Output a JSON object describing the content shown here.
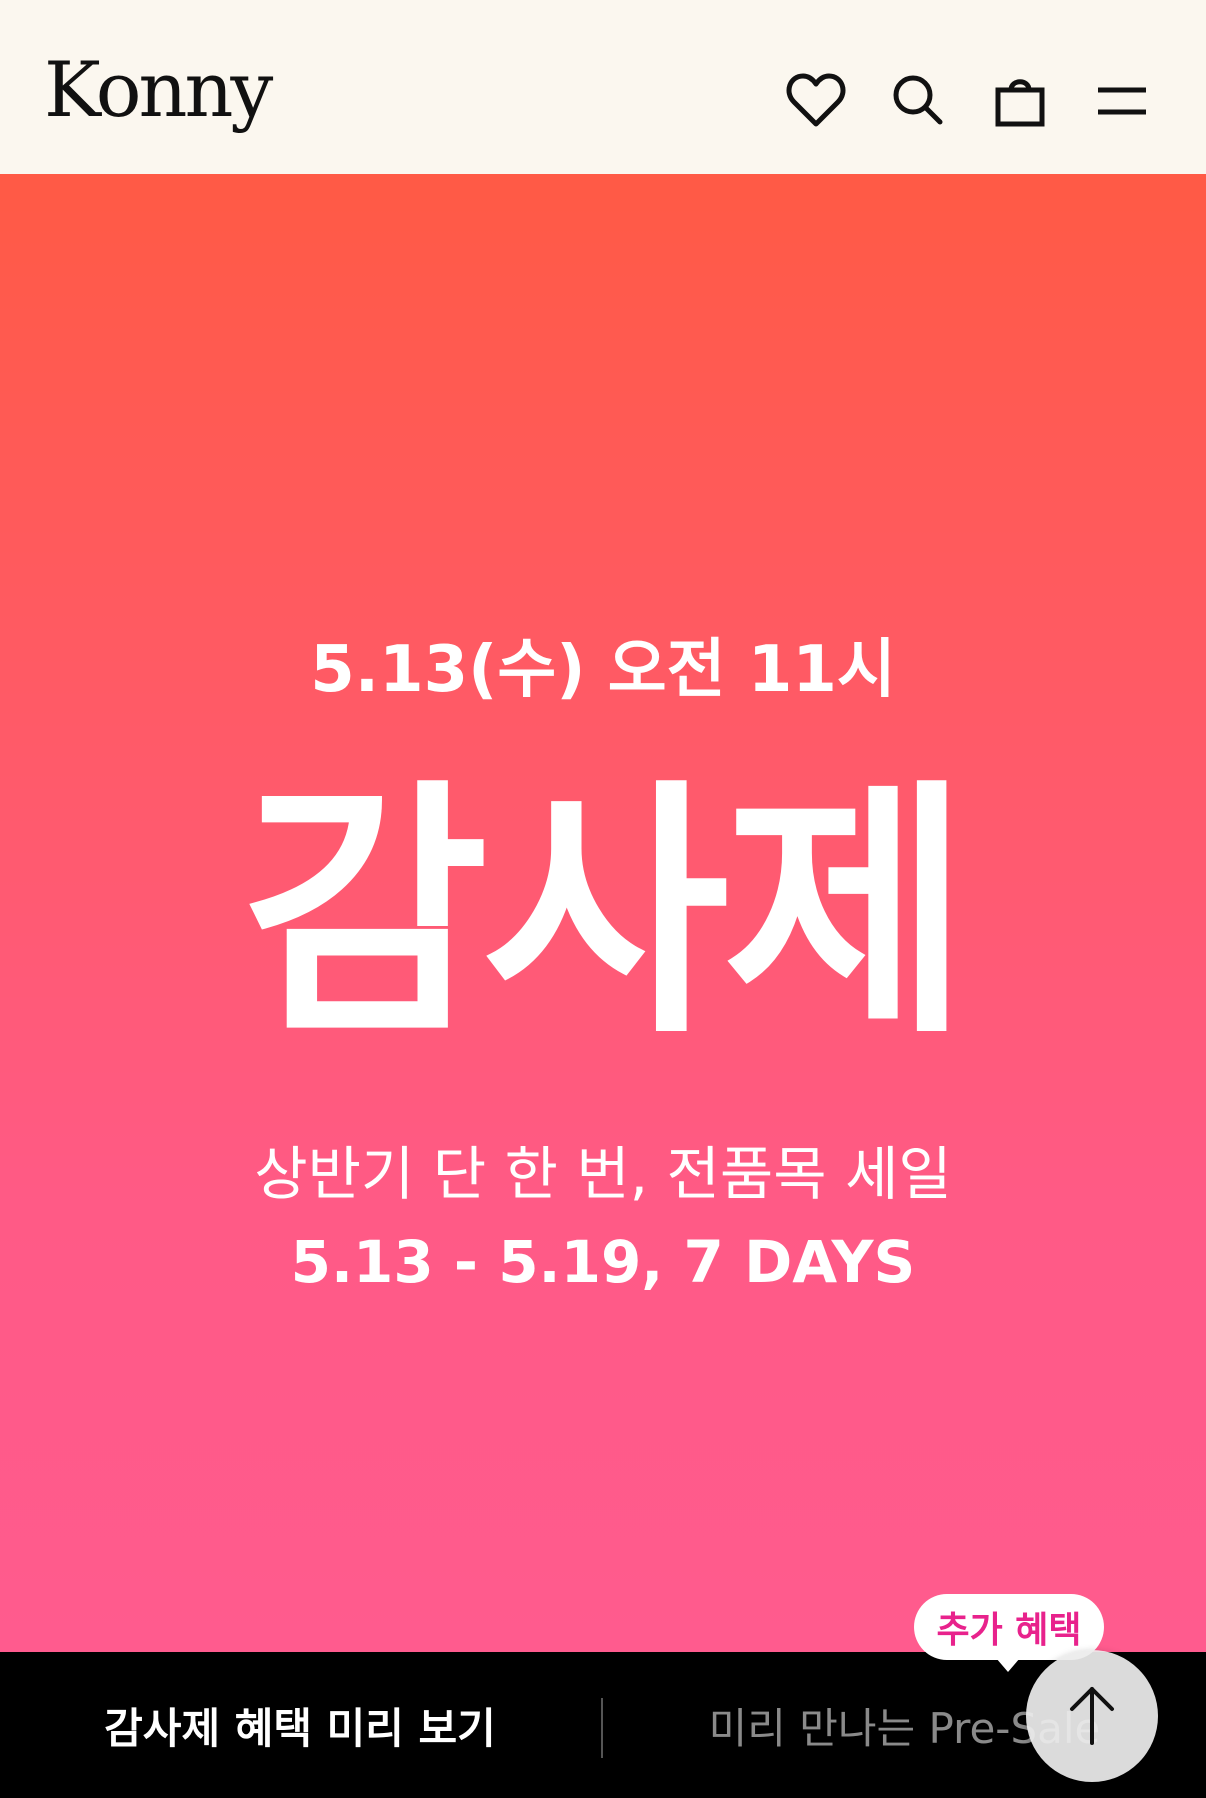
{
  "header": {
    "logo": "Konny",
    "icons": [
      "heart-icon",
      "search-icon",
      "shopping-bag-icon",
      "menu-icon"
    ]
  },
  "hero": {
    "date_line": "5.13(수) 오전 11시",
    "title": "감사제",
    "subtitle": "상반기 단 한 번, 전품목 세일",
    "period": "5.13 - 5.19, 7 DAYS",
    "gradient_top": "#ff5a45",
    "gradient_bottom": "#ff5b8e"
  },
  "bottom_bar": {
    "left_label": "감사제 혜택 미리 보기",
    "right_label": "미리 만나는 Pre-Sale"
  },
  "tooltip": {
    "label": "추가 혜택",
    "color": "#e8228c"
  },
  "scroll_top": {
    "icon": "arrow-up-icon"
  }
}
